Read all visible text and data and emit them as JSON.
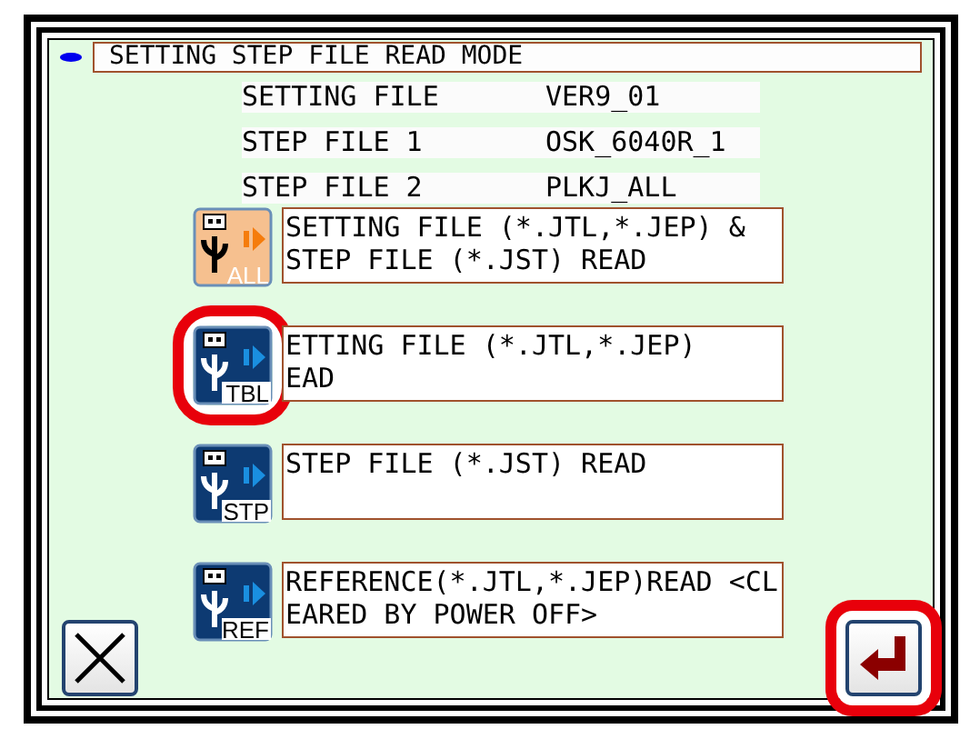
{
  "title": "SETTING STEP FILE READ MODE",
  "files": [
    {
      "label": "SETTING FILE",
      "value": "VER9_01"
    },
    {
      "label": "STEP FILE 1",
      "value": "OSK_6040R_1"
    },
    {
      "label": "STEP FILE 2",
      "value": "PLKJ_ALL"
    }
  ],
  "options": [
    {
      "kind": "all",
      "badge": "ALL",
      "lines": [
        "SETTING FILE (*.JTL,*.JEP) &",
        "STEP FILE (*.JST) READ"
      ],
      "highlighted": false
    },
    {
      "kind": "tbl",
      "badge": "TBL",
      "lines": [
        "ETTING FILE (*.JTL,*.JEP)",
        "EAD"
      ],
      "highlighted": true
    },
    {
      "kind": "stp",
      "badge": "STP",
      "lines": [
        "STEP FILE (*.JST) READ"
      ],
      "highlighted": false
    },
    {
      "kind": "ref",
      "badge": "REF",
      "lines": [
        "REFERENCE(*.JTL,*.JEP)READ <CL",
        "EARED BY POWER OFF>"
      ],
      "highlighted": false
    }
  ],
  "cancel_button": {
    "highlighted": false
  },
  "enter_button": {
    "highlighted": true
  }
}
